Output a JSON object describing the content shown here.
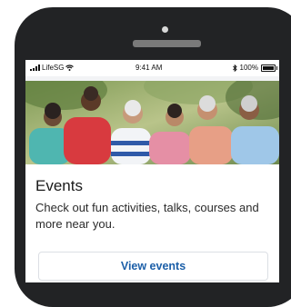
{
  "status_bar": {
    "carrier": "LifeSG",
    "time": "9:41 AM",
    "battery": "100%",
    "icons": [
      "signal-icon",
      "wifi-icon",
      "bluetooth-icon",
      "battery-icon"
    ]
  },
  "hero": {
    "image": "group-of-smiling-seniors-outdoors"
  },
  "card": {
    "title": "Events",
    "description": "Check out fun activities, talks, courses and more near you.",
    "button_label": "View events"
  },
  "colors": {
    "phone_frame": "#222325",
    "button_text": "#1c5fa8",
    "screen_bg": "#f2f3f5"
  }
}
